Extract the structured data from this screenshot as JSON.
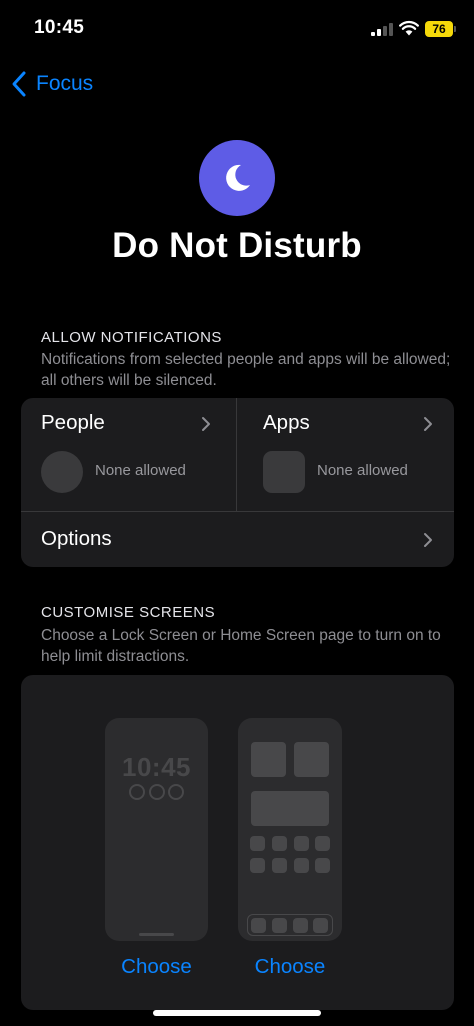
{
  "status_bar": {
    "time": "10:45",
    "battery_level": "76",
    "battery_color": "#f5d90a",
    "signal_icon": "cellular-signal-icon",
    "wifi_icon": "wifi-icon"
  },
  "nav": {
    "back_label": "Focus",
    "back_icon": "chevron-left-icon"
  },
  "header": {
    "focus_icon": "moon-icon",
    "focus_icon_color": "#5e5ce6",
    "title": "Do Not Disturb"
  },
  "allow_notifications": {
    "title": "ALLOW NOTIFICATIONS",
    "description": "Notifications from selected people and apps will be allowed; all others will be silenced.",
    "people": {
      "label": "People",
      "status": "None allowed"
    },
    "apps": {
      "label": "Apps",
      "status": "None allowed"
    },
    "options": {
      "label": "Options"
    }
  },
  "customise_screens": {
    "title": "CUSTOMISE SCREENS",
    "description": "Choose a Lock Screen or Home Screen page to turn on to help limit distractions.",
    "lock_screen": {
      "preview_time": "10:45",
      "choose_label": "Choose"
    },
    "home_screen": {
      "choose_label": "Choose"
    }
  },
  "colors": {
    "accent": "#0a84ff",
    "background": "#000000",
    "card": "#1c1c1e"
  }
}
